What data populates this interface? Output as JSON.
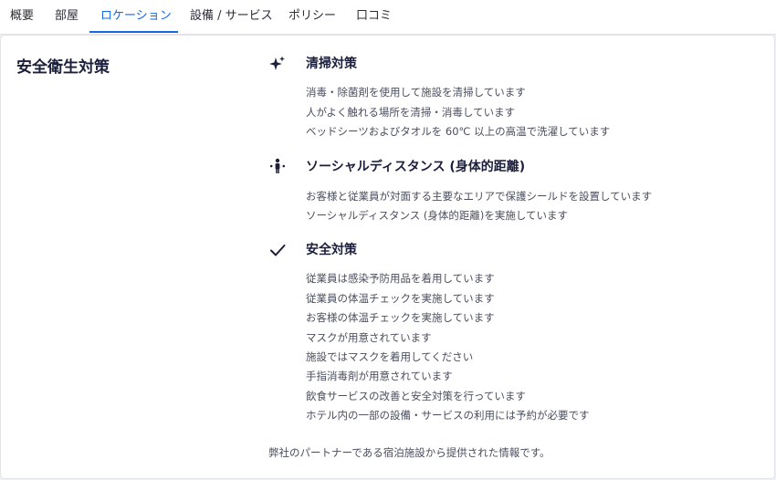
{
  "tabs": [
    {
      "label": "概要"
    },
    {
      "label": "部屋"
    },
    {
      "label": "ロケーション",
      "active": true
    },
    {
      "label": "設備 / サービス"
    },
    {
      "label": "ポリシー"
    },
    {
      "label": "口コミ"
    }
  ],
  "section": {
    "title": "安全衛生対策"
  },
  "groups": [
    {
      "icon": "sparkle-icon",
      "heading": "清掃対策",
      "items": [
        "消毒・除菌剤を使用して施設を清掃しています",
        "人がよく触れる場所を清掃・消毒しています",
        "ベッドシーツおよびタオルを 60℃ 以上の高温で洗濯しています"
      ]
    },
    {
      "icon": "social-distance-icon",
      "heading": "ソーシャルディスタンス (身体的距離)",
      "items": [
        "お客様と従業員が対面する主要なエリアで保護シールドを設置しています",
        "ソーシャルディスタンス (身体的距離)を実施しています"
      ]
    },
    {
      "icon": "checkmark-icon",
      "heading": "安全対策",
      "items": [
        "従業員は感染予防用品を着用しています",
        "従業員の体温チェックを実施しています",
        "お客様の体温チェックを実施しています",
        "マスクが用意されています",
        "施設ではマスクを着用してください",
        "手指消毒剤が用意されています",
        "飲食サービスの改善と安全対策を行っています",
        "ホテル内の一部の設備・サービスの利用には予約が必要です"
      ]
    }
  ],
  "footer": {
    "note": "弊社のパートナーである宿泊施設から提供された情報です。"
  },
  "colors": {
    "accent": "#1668e3",
    "heading": "#1b1f3b",
    "body_text": "#4a4e5e"
  }
}
